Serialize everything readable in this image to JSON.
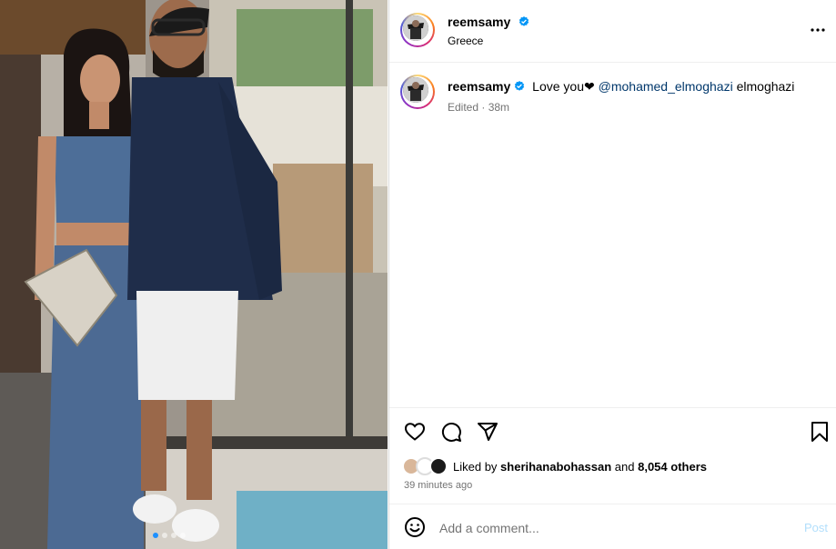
{
  "post": {
    "author": "reemsamy",
    "location": "Greece",
    "verified": true,
    "caption_author": "reemsamy",
    "caption_text": "Love you❤",
    "caption_mention": "@mohamed_elmoghazi",
    "caption_suffix": "elmoghazi",
    "edited_label": "Edited · 38m",
    "liked_by_prefix": "Liked by",
    "liked_by_user": "sherihanabohassan",
    "liked_by_and": "and",
    "liked_by_others": "8,054 others",
    "timestamp": "39 minutes ago",
    "carousel_dots": 4,
    "active_dot": 0
  },
  "comment_box": {
    "placeholder": "Add a comment...",
    "post_label": "Post"
  },
  "icons": {
    "more": "more-horizontal-icon",
    "like": "heart-icon",
    "comment": "comment-icon",
    "share": "send-icon",
    "save": "bookmark-icon",
    "emoji": "emoji-icon",
    "verified": "verified-badge-icon"
  },
  "colors": {
    "verified_blue": "#0095f6",
    "mention_blue": "#00376b",
    "muted_text": "#737373",
    "post_button_disabled": "#b2dffc",
    "story_ring": [
      "#feda75",
      "#fa7e1e",
      "#d62976",
      "#962fbf",
      "#4f5bd5"
    ]
  }
}
